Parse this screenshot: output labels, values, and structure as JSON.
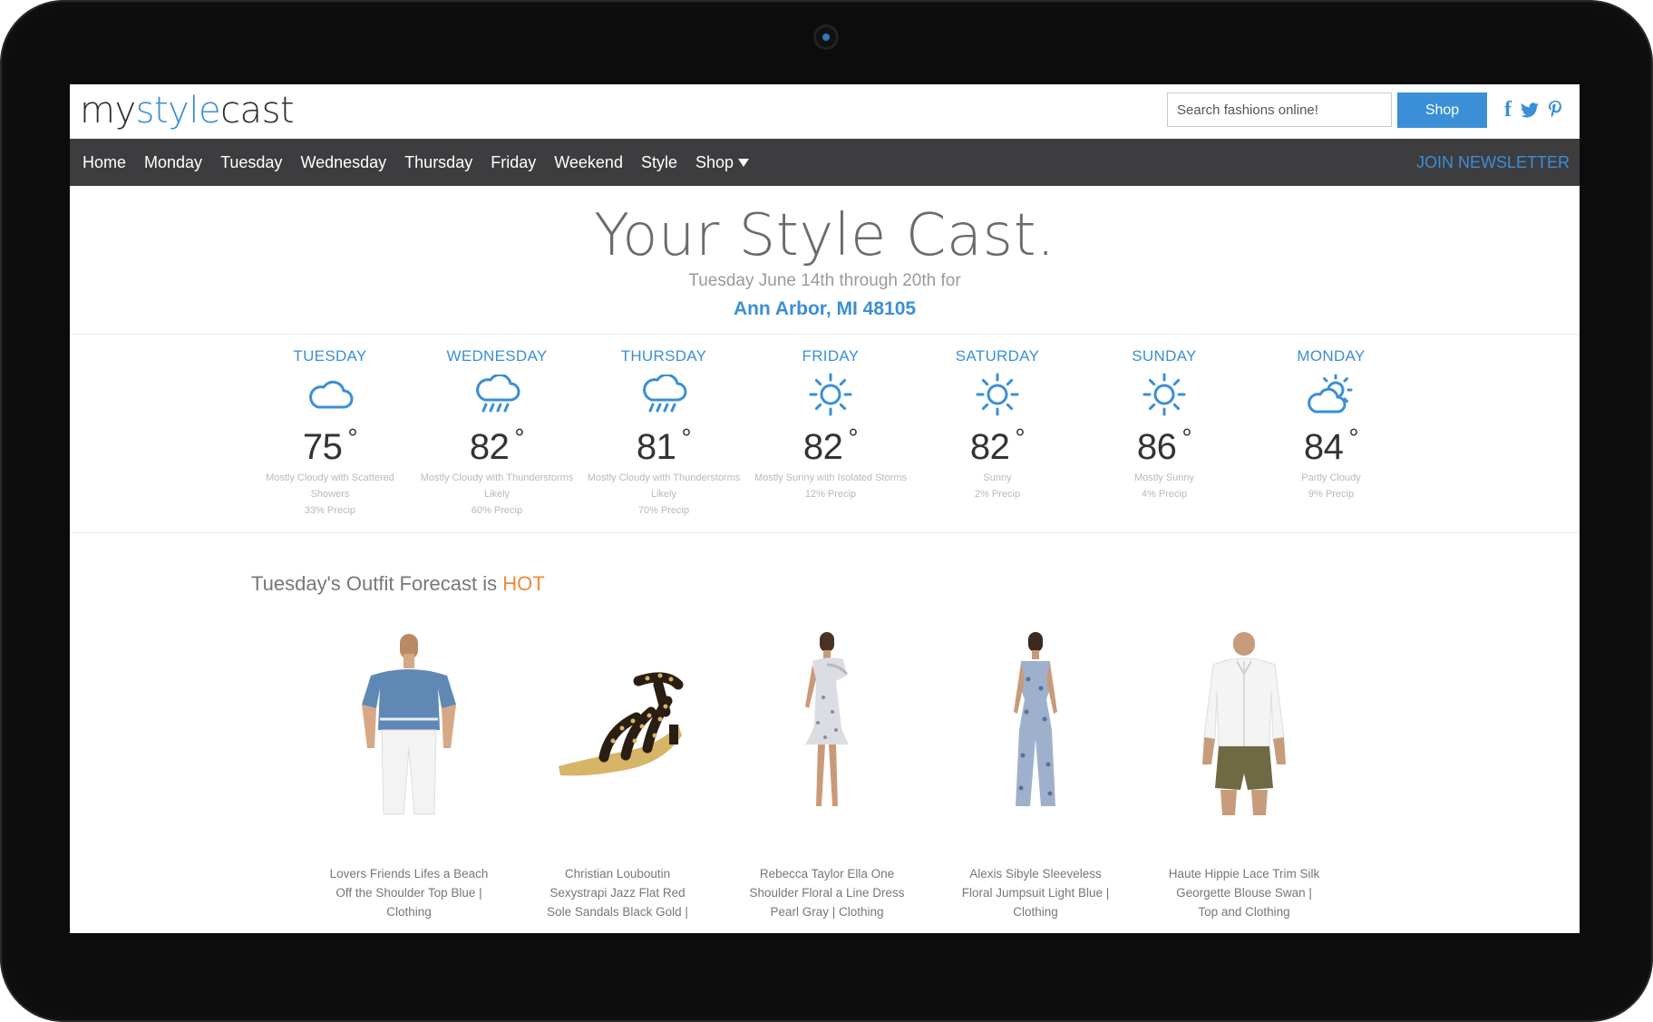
{
  "header": {
    "logo": {
      "part1": "my",
      "part2": "style",
      "part3": "cast"
    },
    "search_placeholder": "Search fashions online!",
    "shop_button": "Shop"
  },
  "social": {
    "facebook": "facebook-icon",
    "twitter": "twitter-icon",
    "pinterest": "pinterest-icon"
  },
  "nav": {
    "items": [
      "Home",
      "Monday",
      "Tuesday",
      "Wednesday",
      "Thursday",
      "Friday",
      "Weekend",
      "Style",
      "Shop"
    ],
    "newsletter": "JOIN NEWSLETTER"
  },
  "hero": {
    "title": "Your Style Cast.",
    "subtitle": "Tuesday June 14th through 20th for",
    "location": "Ann Arbor, MI 48105"
  },
  "forecast": [
    {
      "day": "TUESDAY",
      "icon": "cloud-icon",
      "temp": "75",
      "deg": "°",
      "desc1": "Mostly Cloudy with Scattered",
      "desc2": "Showers",
      "precip": "33% Precip"
    },
    {
      "day": "WEDNESDAY",
      "icon": "rain-cloud-icon",
      "temp": "82",
      "deg": "°",
      "desc1": "Mostly Cloudy with Thunderstorms",
      "desc2": "Likely",
      "precip": "60% Precip"
    },
    {
      "day": "THURSDAY",
      "icon": "rain-cloud-icon",
      "temp": "81",
      "deg": "°",
      "desc1": "Mostly Cloudy with Thunderstorms",
      "desc2": "Likely",
      "precip": "70% Precip"
    },
    {
      "day": "FRIDAY",
      "icon": "sun-icon",
      "temp": "82",
      "deg": "°",
      "desc1": "Mostly Sunny with Isolated Storms",
      "desc2": "12% Precip",
      "precip": ""
    },
    {
      "day": "SATURDAY",
      "icon": "sun-icon",
      "temp": "82",
      "deg": "°",
      "desc1": "Sunny",
      "desc2": "2% Precip",
      "precip": ""
    },
    {
      "day": "SUNDAY",
      "icon": "sun-icon",
      "temp": "86",
      "deg": "°",
      "desc1": "Mostly Sunny",
      "desc2": "4% Precip",
      "precip": ""
    },
    {
      "day": "MONDAY",
      "icon": "partly-cloudy-icon",
      "temp": "84",
      "deg": "°",
      "desc1": "Partly Cloudy",
      "desc2": "9% Precip",
      "precip": ""
    }
  ],
  "outfit": {
    "title_prefix": "Tuesday's Outfit Forecast is",
    "title_level": "HOT",
    "products": [
      {
        "line1": "Lovers Friends Lifes a Beach",
        "line2": "Off the Shoulder Top Blue |",
        "line3": "Clothing",
        "image": "off-shoulder-top-image"
      },
      {
        "line1": "Christian Louboutin",
        "line2": "Sexystrapi Jazz Flat Red",
        "line3": "Sole Sandals Black Gold |",
        "image": "studded-sandal-image"
      },
      {
        "line1": "Rebecca Taylor Ella One",
        "line2": "Shoulder Floral a Line Dress",
        "line3": "Pearl Gray | Clothing",
        "image": "floral-dress-image"
      },
      {
        "line1": "Alexis Sibyle Sleeveless",
        "line2": "Floral Jumpsuit Light Blue |",
        "line3": "Clothing",
        "image": "floral-jumpsuit-image"
      },
      {
        "line1": "Haute Hippie Lace Trim Silk",
        "line2": "Georgette Blouse Swan |",
        "line3": "Top and Clothing",
        "image": "lace-blouse-image"
      }
    ]
  },
  "colors": {
    "accent": "#3a8fd6",
    "nav_bg": "#3d3d40",
    "hot": "#ef8a3a"
  }
}
